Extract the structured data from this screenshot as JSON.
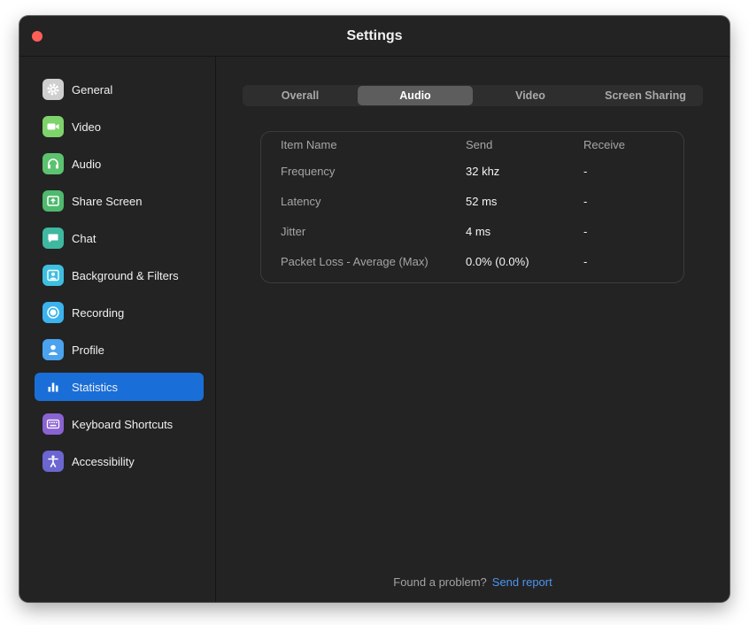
{
  "window": {
    "title": "Settings",
    "close_color": "#ff5f57"
  },
  "sidebar": {
    "items": [
      {
        "label": "General",
        "icon": "gear-icon",
        "color": "#cfcfcf"
      },
      {
        "label": "Video",
        "icon": "video-camera-icon",
        "color": "#7ed36b"
      },
      {
        "label": "Audio",
        "icon": "headphones-icon",
        "color": "#5cc26f"
      },
      {
        "label": "Share Screen",
        "icon": "share-screen-icon",
        "color": "#4fb96d"
      },
      {
        "label": "Chat",
        "icon": "chat-bubble-icon",
        "color": "#3fb8a0"
      },
      {
        "label": "Background & Filters",
        "icon": "portrait-icon",
        "color": "#3ebfe0"
      },
      {
        "label": "Recording",
        "icon": "record-icon",
        "color": "#3bb3ee"
      },
      {
        "label": "Profile",
        "icon": "person-icon",
        "color": "#4ba3ef"
      },
      {
        "label": "Statistics",
        "icon": "bar-chart-icon",
        "color": "#1a6ed8",
        "active": true
      },
      {
        "label": "Keyboard Shortcuts",
        "icon": "keyboard-icon",
        "color": "#8a63d2"
      },
      {
        "label": "Accessibility",
        "icon": "accessibility-icon",
        "color": "#6b66d0"
      }
    ]
  },
  "tabs": [
    {
      "label": "Overall"
    },
    {
      "label": "Audio",
      "active": true
    },
    {
      "label": "Video"
    },
    {
      "label": "Screen Sharing"
    }
  ],
  "stats": {
    "headers": [
      "Item Name",
      "Send",
      "Receive"
    ],
    "rows": [
      [
        "Frequency",
        "32 khz",
        "-"
      ],
      [
        "Latency",
        "52 ms",
        "-"
      ],
      [
        "Jitter",
        "4 ms",
        "-"
      ],
      [
        "Packet Loss - Average (Max)",
        "0.0% (0.0%)",
        "-"
      ]
    ]
  },
  "footer": {
    "question": "Found a problem?",
    "link": "Send report",
    "link_color": "#4b95f2"
  },
  "accent": "#1a6ed8"
}
